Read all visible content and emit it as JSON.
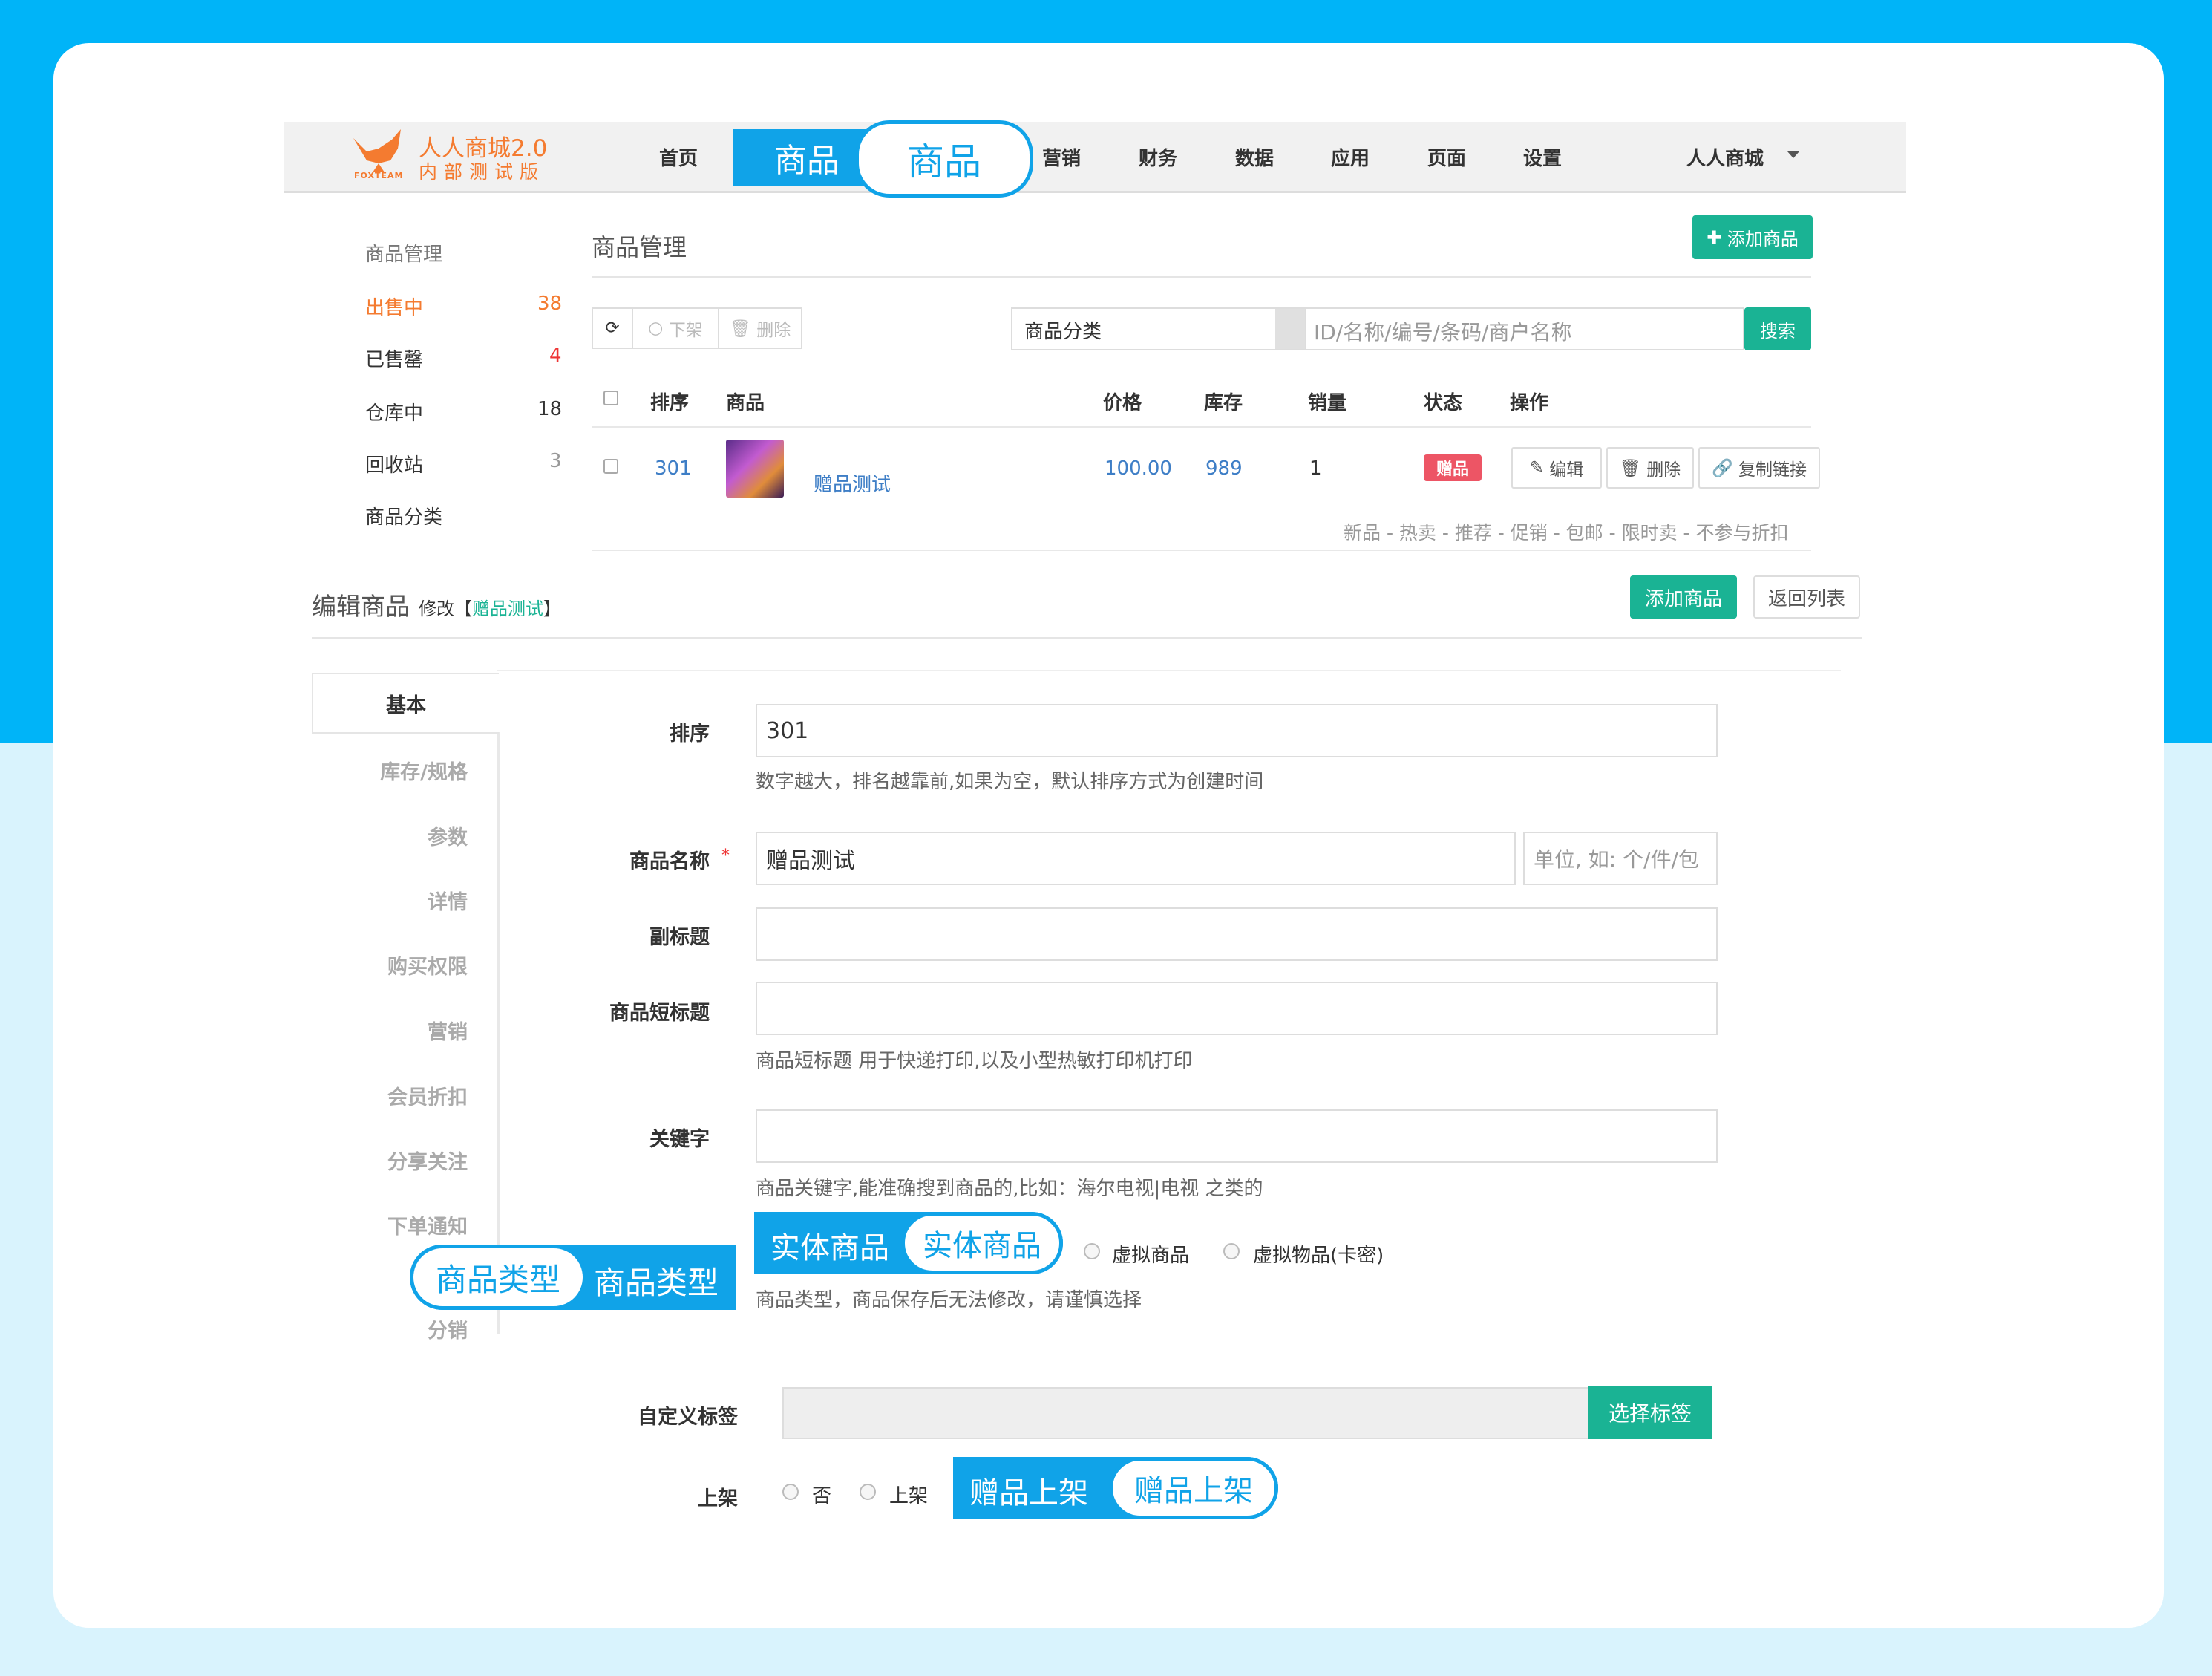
{
  "app": {
    "logo_title": "人人商城2.0",
    "logo_subtitle": "内部测试版",
    "logo_brand": "FOXTEAM"
  },
  "nav": {
    "items": [
      "首页",
      "营销",
      "财务",
      "数据",
      "应用",
      "页面",
      "设置"
    ],
    "active": "商品",
    "active_callout": "商品",
    "user": "人人商城"
  },
  "sidebar": {
    "title": "商品管理",
    "items": [
      {
        "label": "出售中",
        "count": "38",
        "color": "#f47b30"
      },
      {
        "label": "已售罄",
        "count": "4",
        "color": "#e33"
      },
      {
        "label": "仓库中",
        "count": "18",
        "color": "#333"
      },
      {
        "label": "回收站",
        "count": "3",
        "color": "#999"
      },
      {
        "label": "商品分类",
        "count": ""
      }
    ]
  },
  "goods": {
    "title": "商品管理",
    "add_button": "添加商品",
    "toolbar": {
      "off_shelf": "下架",
      "delete": "删除"
    },
    "category_select": "商品分类",
    "search_placeholder": "ID/名称/编号/条码/商户名称",
    "search_button": "搜索",
    "columns": [
      "排序",
      "商品",
      "价格",
      "库存",
      "销量",
      "状态",
      "操作"
    ],
    "rows": [
      {
        "order": "301",
        "name": "赠品测试",
        "price": "100.00",
        "stock": "989",
        "sales": "1",
        "status": "赠品"
      }
    ],
    "actions": [
      "编辑",
      "删除",
      "复制链接"
    ],
    "flags": "新品 - 热卖 - 推荐 - 促销 - 包邮 - 限时卖 - 不参与折扣"
  },
  "edit": {
    "title": "编辑商品",
    "subtitle_prefix": "修改【",
    "subtitle_link": "赠品测试",
    "subtitle_suffix": "】",
    "add_button": "添加商品",
    "back_button": "返回列表",
    "tabs": [
      "基本",
      "库存/规格",
      "参数",
      "详情",
      "购买权限",
      "营销",
      "会员折扣",
      "分享关注",
      "下单通知",
      "分销"
    ],
    "fields": {
      "order_label": "排序",
      "order_value": "301",
      "order_help": "数字越大，排名越靠前,如果为空，默认排序方式为创建时间",
      "name_label": "商品名称",
      "name_required": "*",
      "name_value": "赠品测试",
      "unit_placeholder": "单位, 如: 个/件/包",
      "subtitle_label": "副标题",
      "short_title_label": "商品短标题",
      "short_title_help": "商品短标题 用于快递打印,以及小型热敏打印机打印",
      "keyword_label": "关键字",
      "keyword_help": "商品关键字,能准确搜到商品的,比如：海尔电视|电视 之类的",
      "type_label": "商品类型",
      "type_callout": "商品类型",
      "type_options": [
        "实体商品",
        "虚拟商品",
        "虚拟物品(卡密)"
      ],
      "type_selected_callout": "实体商品",
      "type_help": "商品类型，商品保存后无法修改，请谨慎选择",
      "tags_label": "自定义标签",
      "tags_button": "选择标签",
      "shelf_label": "上架",
      "shelf_options": [
        "否",
        "上架",
        "赠品上架"
      ],
      "shelf_callout": "赠品上架"
    }
  },
  "colors": {
    "accent_blue": "#10a3e8",
    "green": "#1ab394",
    "orange": "#f47b30",
    "red": "#ed5565"
  }
}
